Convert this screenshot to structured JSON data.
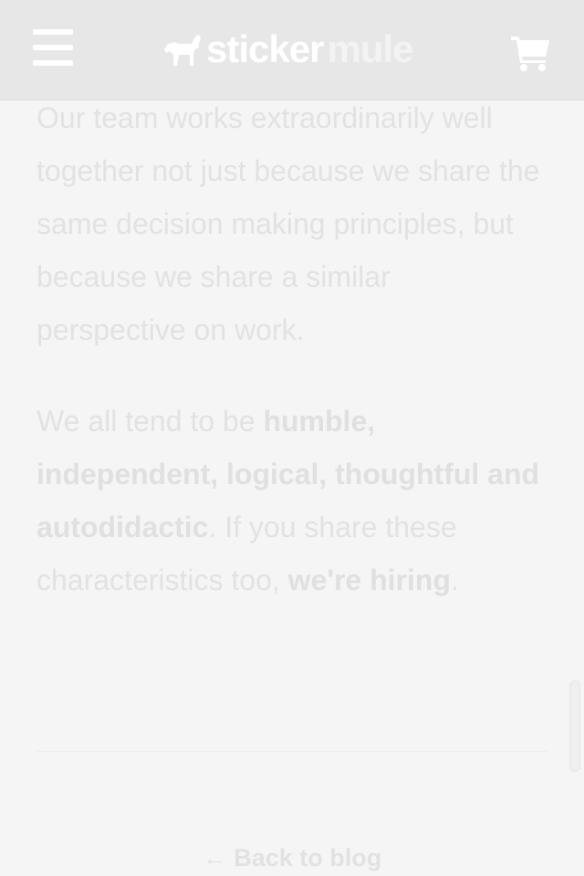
{
  "header": {
    "logo_word_1": "sticker",
    "logo_word_2": "mule",
    "menu_icon": "hamburger-icon",
    "cart_icon": "shopping-cart-icon"
  },
  "article": {
    "paragraph_1": "Our team works extraordinarily well together not just because we share the same decision making principles, but because we share a similar perspective on work.",
    "paragraph_2": {
      "lead": "We all tend to be ",
      "traits": "humble, independent, logical, thoughtful and autodidactic",
      "middle": ". If you share these characteristics too, ",
      "link": "we're hiring",
      "end": "."
    }
  },
  "footer": {
    "back_arrow": "←",
    "back_label": "Back to blog"
  }
}
